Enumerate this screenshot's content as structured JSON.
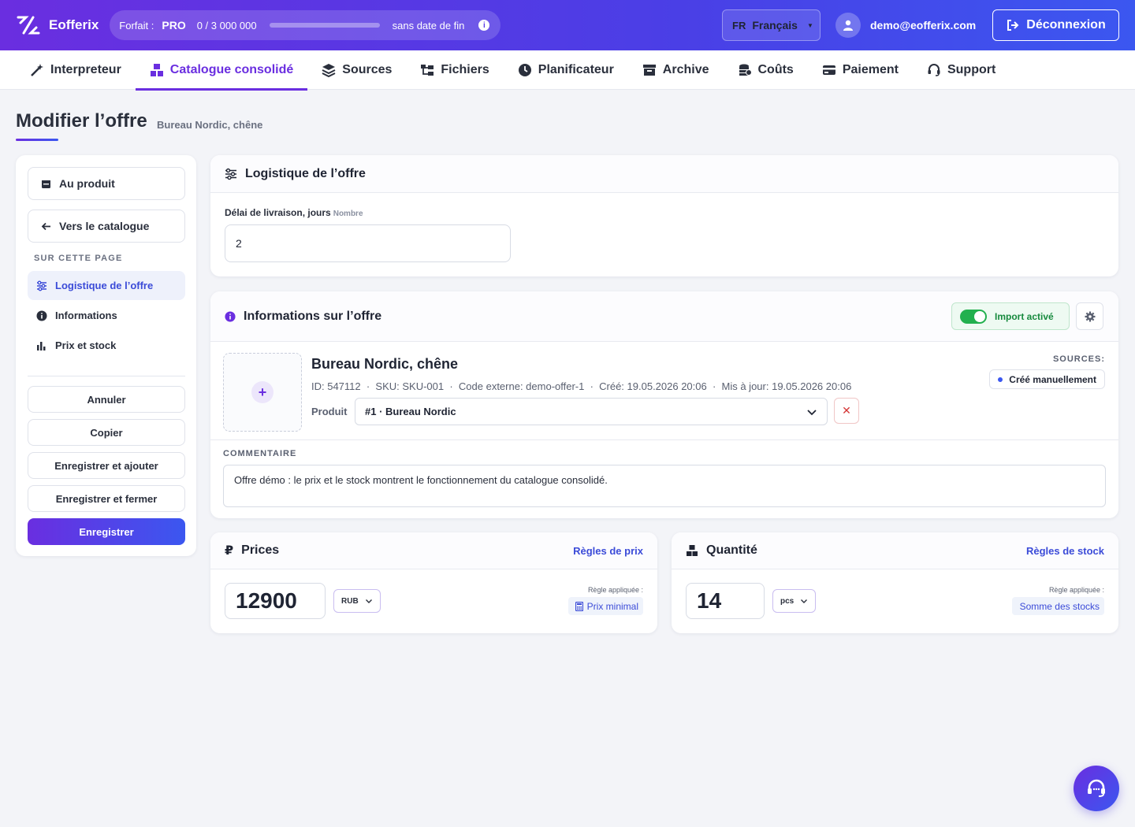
{
  "brand": {
    "name": "Eofferix"
  },
  "plan": {
    "label": "Forfait :",
    "name": "PRO",
    "usage": "0 / 3 000 000",
    "period": "sans date de fin",
    "usage_fraction": 0
  },
  "language": {
    "code": "FR",
    "label": "Français"
  },
  "user": {
    "email": "demo@eofferix.com"
  },
  "logout_label": "Déconnexion",
  "nav": [
    {
      "label": "Interpreteur",
      "icon": "magic-wand-icon"
    },
    {
      "label": "Catalogue consolidé",
      "icon": "boxes-icon",
      "active": true
    },
    {
      "label": "Sources",
      "icon": "layers-icon"
    },
    {
      "label": "Fichiers",
      "icon": "folder-tree-icon"
    },
    {
      "label": "Planificateur",
      "icon": "clock-icon"
    },
    {
      "label": "Archive",
      "icon": "archive-icon"
    },
    {
      "label": "Coûts",
      "icon": "coins-icon"
    },
    {
      "label": "Paiement",
      "icon": "credit-card-icon"
    },
    {
      "label": "Support",
      "icon": "headset-icon"
    }
  ],
  "page": {
    "title": "Modifier l’offre",
    "subtitle": "Bureau Nordic, chêne"
  },
  "sidebar": {
    "to_product": "Au produit",
    "to_catalog": "Vers le catalogue",
    "section_heading": "SUR CETTE PAGE",
    "links": [
      {
        "label": "Logistique de l’offre",
        "active": true
      },
      {
        "label": "Informations"
      },
      {
        "label": "Prix et stock"
      }
    ],
    "actions": {
      "cancel": "Annuler",
      "copy": "Copier",
      "save_add": "Enregistrer et ajouter",
      "save_close": "Enregistrer et fermer",
      "save": "Enregistrer"
    }
  },
  "logistics": {
    "title": "Logistique de l’offre",
    "delivery_label": "Délai de livraison, jours",
    "delivery_hint": "Nombre",
    "delivery_value": "2"
  },
  "info": {
    "title": "Informations sur l’offre",
    "import_label": "Import activé",
    "offer_name": "Bureau Nordic, chêne",
    "meta": "ID: 547112  ·  SKU: SKU-001  ·  Code externe: demo-offer-1  ·  Créé: 19.05.2026 20:06  ·  Mis à jour: 19.05.2026 20:06",
    "product_label": "Produit",
    "product_value": "#1 · Bureau Nordic",
    "sources_label": "SOURCES:",
    "source_value": "Créé manuellement",
    "comment_label": "COMMENTAIRE",
    "comment_value": "Offre démo : le prix et le stock montrent le fonctionnement du catalogue consolidé."
  },
  "prices": {
    "title": "Prices",
    "rules_link": "Règles de prix",
    "value": "12900",
    "currency": "RUB",
    "rule_applied_label": "Règle appliquée :",
    "rule_applied": "Prix minimal"
  },
  "quantity": {
    "title": "Quantité",
    "rules_link": "Règles de stock",
    "value": "14",
    "unit": "pcs",
    "rule_applied_label": "Règle appliquée :",
    "rule_applied": "Somme des stocks"
  },
  "colors": {
    "accent": "#6a2ee0",
    "link": "#3b4bd8",
    "success": "#22b04e",
    "danger": "#d43535"
  }
}
